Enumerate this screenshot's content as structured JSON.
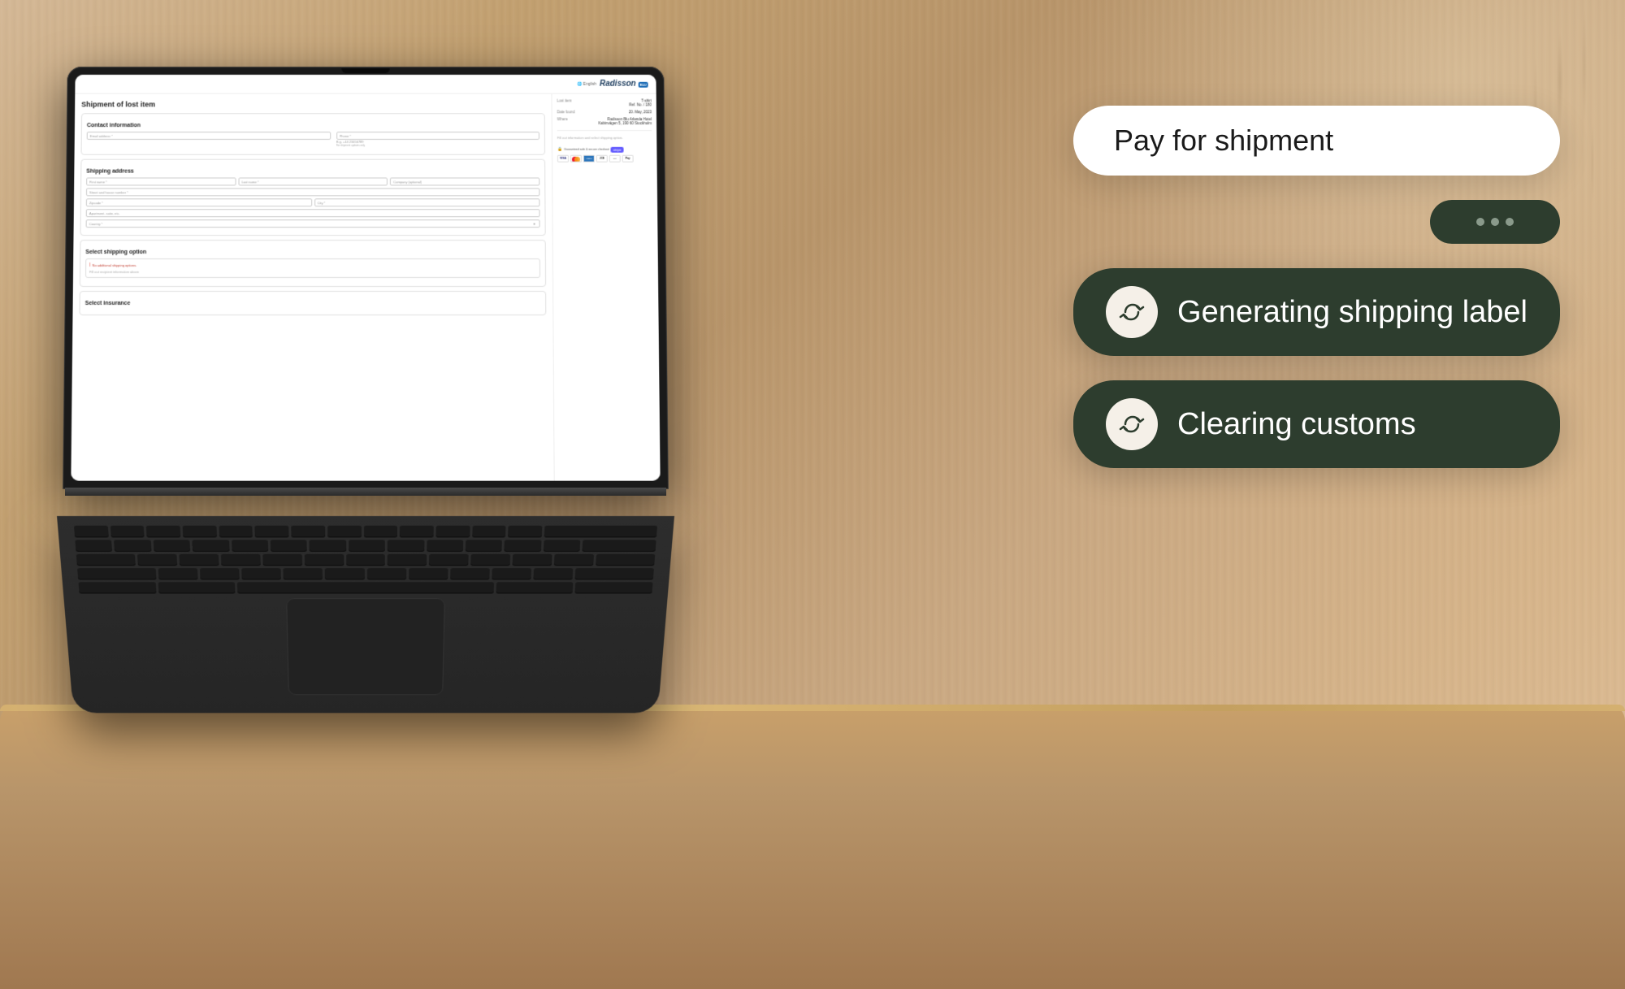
{
  "background": {
    "color": "#c9a882"
  },
  "laptop": {
    "screen": {
      "webpage": {
        "header": {
          "language": "English",
          "hotel_name": "Radisson",
          "hotel_suffix": "BLU"
        },
        "title": "Shipment of lost item",
        "sections": {
          "contact": {
            "title": "Contact information",
            "email_placeholder": "Email address *",
            "phone_placeholder": "Phone *",
            "phone_example": "E.g. +44 23456789",
            "phone_note": "For shipment updates only"
          },
          "shipping_address": {
            "title": "Shipping address",
            "first_name": "First name *",
            "last_name": "Last name *",
            "company": "Company (optional)",
            "street": "Street and house number *",
            "zipcode": "Zipcode *",
            "city": "City *",
            "apartment": "Apartment, suite, etc.",
            "country": "Country *"
          },
          "shipping_option": {
            "title": "Select shipping option",
            "no_options": "No additional shipping options.",
            "fill_notice": "Fill out recipient information above"
          },
          "insurance": {
            "title": "Select insurance"
          }
        },
        "item_info": {
          "lost_item_label": "Lost item",
          "lost_item_value": "T-shirt",
          "lost_item_ref": "Ref. No. / 180",
          "date_found_label": "Date found",
          "date_found_value": "20. May, 2023",
          "where_label": "Where",
          "where_value": "Radisson Blu Arlanda Hotel",
          "where_address": "Kabinvägen 5, 190 60 Stockholm"
        },
        "checkout": {
          "placeholder": "Fill out information and select shipping option.",
          "secure_text": "Guaranteed safe & secure checkout",
          "stripe": "stripe",
          "payment_methods": [
            "VISA",
            "MC",
            "AMEX",
            "JCB",
            "Diners",
            "Apple Pay"
          ]
        }
      }
    }
  },
  "overlay_cards": {
    "pay_shipment": {
      "text": "Pay for shipment"
    },
    "dots": {
      "count": 3
    },
    "generating_label": {
      "text": "Generating shipping label",
      "icon": "return-arrow-icon"
    },
    "clearing_customs": {
      "text": "Clearing customs",
      "icon": "return-arrow-icon"
    }
  },
  "colors": {
    "dark_green": "#2d3d2e",
    "feature_icon_bg": "#f5f0e8",
    "card_white": "#ffffff",
    "text_dark": "#1a1a1a"
  }
}
